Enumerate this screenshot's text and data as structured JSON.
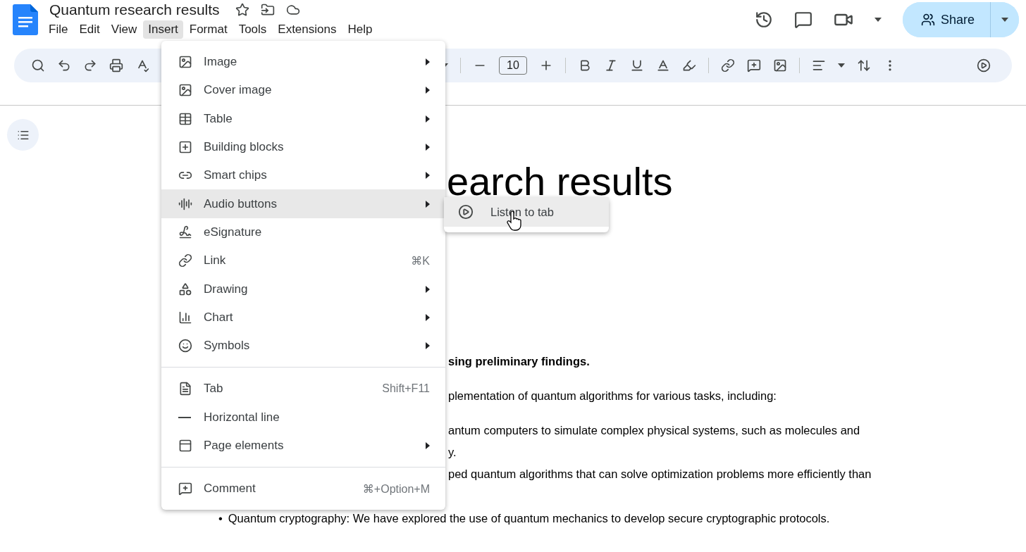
{
  "document": {
    "title": "Quantum research results"
  },
  "menu_bar": [
    {
      "label": "File",
      "selected": false
    },
    {
      "label": "Edit",
      "selected": false
    },
    {
      "label": "View",
      "selected": false
    },
    {
      "label": "Insert",
      "selected": true
    },
    {
      "label": "Format",
      "selected": false
    },
    {
      "label": "Tools",
      "selected": false
    },
    {
      "label": "Extensions",
      "selected": false
    },
    {
      "label": "Help",
      "selected": false
    }
  ],
  "share_button": {
    "label": "Share"
  },
  "toolbar": {
    "font_size": "10"
  },
  "insert_menu": {
    "items": [
      {
        "kind": "item",
        "label": "Image",
        "submenu": true,
        "selected": false
      },
      {
        "kind": "item",
        "label": "Cover image",
        "submenu": true,
        "selected": false
      },
      {
        "kind": "item",
        "label": "Table",
        "submenu": true,
        "selected": false
      },
      {
        "kind": "item",
        "label": "Building blocks",
        "submenu": true,
        "selected": false
      },
      {
        "kind": "item",
        "label": "Smart chips",
        "submenu": true,
        "selected": false
      },
      {
        "kind": "item",
        "label": "Audio buttons",
        "submenu": true,
        "selected": true
      },
      {
        "kind": "item",
        "label": "eSignature",
        "submenu": false,
        "selected": false
      },
      {
        "kind": "item",
        "label": "Link",
        "shortcut": "⌘K",
        "submenu": false,
        "selected": false
      },
      {
        "kind": "item",
        "label": "Drawing",
        "submenu": true,
        "selected": false
      },
      {
        "kind": "item",
        "label": "Chart",
        "submenu": true,
        "selected": false
      },
      {
        "kind": "item",
        "label": "Symbols",
        "submenu": true,
        "selected": false
      },
      {
        "kind": "divider"
      },
      {
        "kind": "item",
        "label": "Tab",
        "shortcut": "Shift+F11",
        "submenu": false,
        "selected": false
      },
      {
        "kind": "item",
        "label": "Horizontal line",
        "submenu": false,
        "selected": false
      },
      {
        "kind": "item",
        "label": "Page elements",
        "submenu": true,
        "selected": false
      },
      {
        "kind": "divider"
      },
      {
        "kind": "item",
        "label": "Comment",
        "shortcut": "⌘+Option+M",
        "submenu": false,
        "selected": false
      }
    ]
  },
  "audio_submenu": {
    "items": [
      {
        "label": "Listen to tab",
        "selected": true
      }
    ]
  },
  "document_body": {
    "lines": [
      {
        "kind": "heading",
        "text": "earch results"
      },
      {
        "kind": "bold",
        "text": "sing preliminary findings."
      },
      {
        "kind": "text",
        "text": "plementation of quantum algorithms for various tasks, including:"
      },
      {
        "kind": "text",
        "text": "antum computers to simulate complex physical systems, such as molecules and"
      },
      {
        "kind": "wrap",
        "text": "y."
      },
      {
        "kind": "wrap",
        "text": "ped quantum algorithms that can solve optimization problems more efficiently than"
      },
      {
        "kind": "bullet",
        "bullet": "•",
        "text": "Quantum cryptography: We have explored the use of quantum mechanics to develop secure cryptographic protocols."
      }
    ]
  }
}
